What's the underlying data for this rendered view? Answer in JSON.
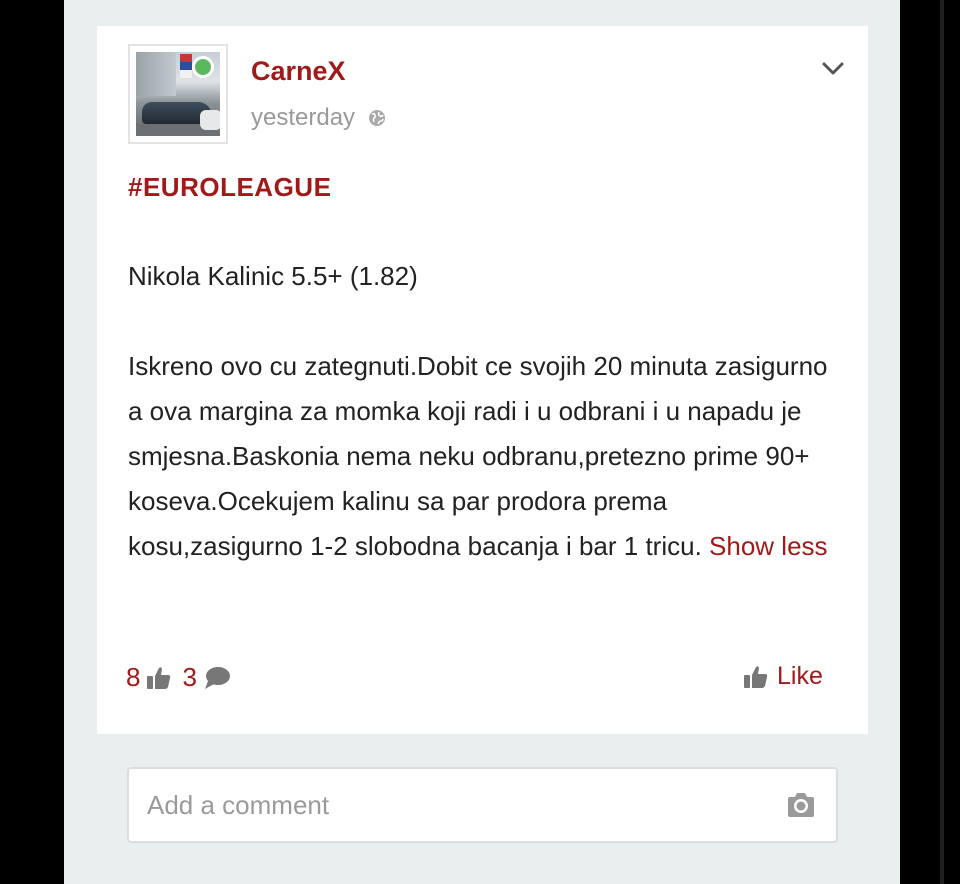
{
  "post": {
    "author": "CarneX",
    "timestamp": "yesterday",
    "hashtag": "#EUROLEAGUE",
    "pick": "Nikola Kalinic 5.5+ (1.82)",
    "text": "Iskreno ovo cu zategnuti.Dobit ce svojih 20 minuta zasigurno a ova margina za momka koji radi i u odbrani i u napadu je smjesna.Baskonia nema neku odbranu,pretezno prime 90+ koseva.Ocekujem kalinu sa par prodora prema kosu,zasigurno 1-2 slobodna bacanja i bar 1 tricu.",
    "show_less": "Show less",
    "likes_count": "8",
    "comments_count": "3",
    "like_label": "Like",
    "online_status": "online"
  },
  "comment": {
    "placeholder": "Add a comment"
  },
  "icons": {
    "menu": "chevron-down-icon",
    "visibility": "globe-icon",
    "likes": "thumbs-up-icon",
    "comments": "speech-bubble-icon",
    "camera": "camera-icon"
  },
  "colors": {
    "accent": "#a01a1a",
    "online": "#5cb85c",
    "background": "#e9eeee",
    "muted": "#9a9a9a"
  }
}
